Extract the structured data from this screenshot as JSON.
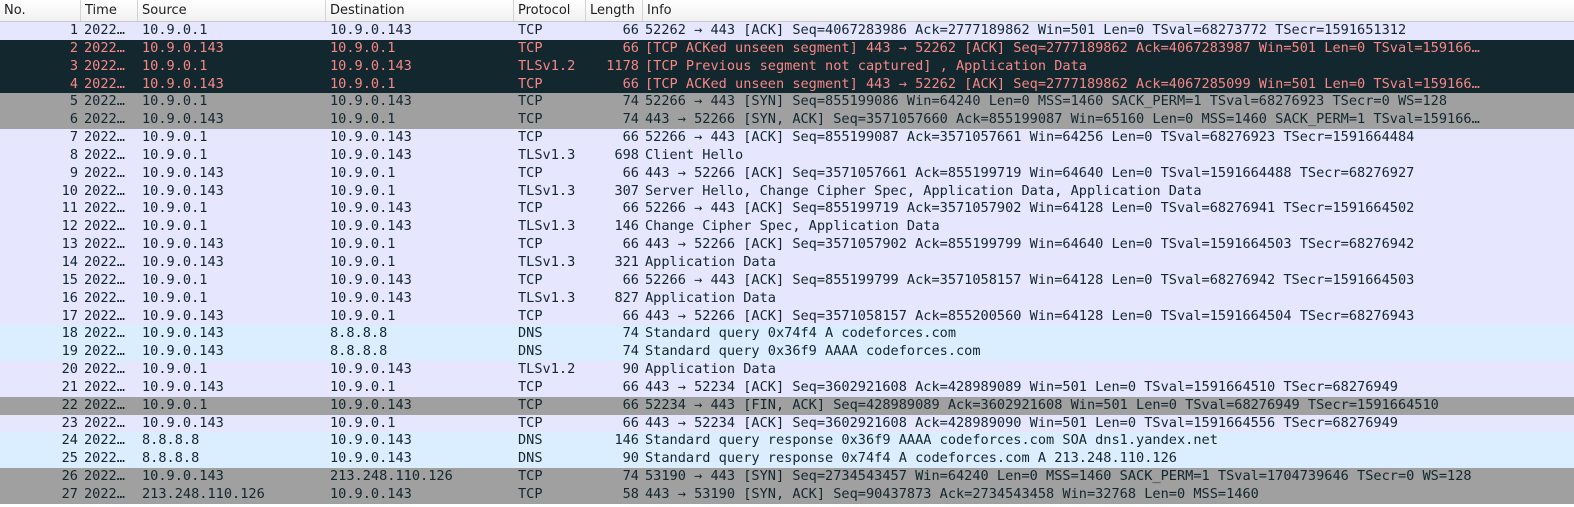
{
  "columns": {
    "no": "No.",
    "time": "Time",
    "source": "Source",
    "destination": "Destination",
    "protocol": "Protocol",
    "length": "Length",
    "info": "Info"
  },
  "row_colors": {
    "tcp": "#e7e6ff",
    "dns": "#daeeff",
    "error_bg": "#12272e",
    "error_text": "#f78787",
    "flag_gray": "#a0a0a0"
  },
  "packets": [
    {
      "no": "1",
      "time": "2022…",
      "source": "10.9.0.1",
      "destination": "10.9.0.143",
      "protocol": "TCP",
      "length": "66",
      "info": "52262 → 443 [ACK] Seq=4067283986 Ack=2777189862 Win=501 Len=0 TSval=68273772 TSecr=1591651312",
      "style": "tcp"
    },
    {
      "no": "2",
      "time": "2022…",
      "source": "10.9.0.143",
      "destination": "10.9.0.1",
      "protocol": "TCP",
      "length": "66",
      "info": "[TCP ACKed unseen segment] 443 → 52262 [ACK] Seq=2777189862 Ack=4067283987 Win=501 Len=0 TSval=159166…",
      "style": "err"
    },
    {
      "no": "3",
      "time": "2022…",
      "source": "10.9.0.1",
      "destination": "10.9.0.143",
      "protocol": "TLSv1.2",
      "length": "1178",
      "info": "[TCP Previous segment not captured] , Application Data",
      "style": "err"
    },
    {
      "no": "4",
      "time": "2022…",
      "source": "10.9.0.143",
      "destination": "10.9.0.1",
      "protocol": "TCP",
      "length": "66",
      "info": "[TCP ACKed unseen segment] 443 → 52262 [ACK] Seq=2777189862 Ack=4067285099 Win=501 Len=0 TSval=159166…",
      "style": "err"
    },
    {
      "no": "5",
      "time": "2022…",
      "source": "10.9.0.1",
      "destination": "10.9.0.143",
      "protocol": "TCP",
      "length": "74",
      "info": "52266 → 443 [SYN] Seq=855199086 Win=64240 Len=0 MSS=1460 SACK_PERM=1 TSval=68276923 TSecr=0 WS=128",
      "style": "syn"
    },
    {
      "no": "6",
      "time": "2022…",
      "source": "10.9.0.143",
      "destination": "10.9.0.1",
      "protocol": "TCP",
      "length": "74",
      "info": "443 → 52266 [SYN, ACK] Seq=3571057660 Ack=855199087 Win=65160 Len=0 MSS=1460 SACK_PERM=1 TSval=159166…",
      "style": "syn"
    },
    {
      "no": "7",
      "time": "2022…",
      "source": "10.9.0.1",
      "destination": "10.9.0.143",
      "protocol": "TCP",
      "length": "66",
      "info": "52266 → 443 [ACK] Seq=855199087 Ack=3571057661 Win=64256 Len=0 TSval=68276923 TSecr=1591664484",
      "style": "tcp"
    },
    {
      "no": "8",
      "time": "2022…",
      "source": "10.9.0.1",
      "destination": "10.9.0.143",
      "protocol": "TLSv1.3",
      "length": "698",
      "info": "Client Hello",
      "style": "tcp"
    },
    {
      "no": "9",
      "time": "2022…",
      "source": "10.9.0.143",
      "destination": "10.9.0.1",
      "protocol": "TCP",
      "length": "66",
      "info": "443 → 52266 [ACK] Seq=3571057661 Ack=855199719 Win=64640 Len=0 TSval=1591664488 TSecr=68276927",
      "style": "tcp"
    },
    {
      "no": "10",
      "time": "2022…",
      "source": "10.9.0.143",
      "destination": "10.9.0.1",
      "protocol": "TLSv1.3",
      "length": "307",
      "info": "Server Hello, Change Cipher Spec, Application Data, Application Data",
      "style": "tcp"
    },
    {
      "no": "11",
      "time": "2022…",
      "source": "10.9.0.1",
      "destination": "10.9.0.143",
      "protocol": "TCP",
      "length": "66",
      "info": "52266 → 443 [ACK] Seq=855199719 Ack=3571057902 Win=64128 Len=0 TSval=68276941 TSecr=1591664502",
      "style": "tcp"
    },
    {
      "no": "12",
      "time": "2022…",
      "source": "10.9.0.1",
      "destination": "10.9.0.143",
      "protocol": "TLSv1.3",
      "length": "146",
      "info": "Change Cipher Spec, Application Data",
      "style": "tcp"
    },
    {
      "no": "13",
      "time": "2022…",
      "source": "10.9.0.143",
      "destination": "10.9.0.1",
      "protocol": "TCP",
      "length": "66",
      "info": "443 → 52266 [ACK] Seq=3571057902 Ack=855199799 Win=64640 Len=0 TSval=1591664503 TSecr=68276942",
      "style": "tcp"
    },
    {
      "no": "14",
      "time": "2022…",
      "source": "10.9.0.143",
      "destination": "10.9.0.1",
      "protocol": "TLSv1.3",
      "length": "321",
      "info": "Application Data",
      "style": "tcp"
    },
    {
      "no": "15",
      "time": "2022…",
      "source": "10.9.0.1",
      "destination": "10.9.0.143",
      "protocol": "TCP",
      "length": "66",
      "info": "52266 → 443 [ACK] Seq=855199799 Ack=3571058157 Win=64128 Len=0 TSval=68276942 TSecr=1591664503",
      "style": "tcp"
    },
    {
      "no": "16",
      "time": "2022…",
      "source": "10.9.0.1",
      "destination": "10.9.0.143",
      "protocol": "TLSv1.3",
      "length": "827",
      "info": "Application Data",
      "style": "tcp"
    },
    {
      "no": "17",
      "time": "2022…",
      "source": "10.9.0.143",
      "destination": "10.9.0.1",
      "protocol": "TCP",
      "length": "66",
      "info": "443 → 52266 [ACK] Seq=3571058157 Ack=855200560 Win=64128 Len=0 TSval=1591664504 TSecr=68276943",
      "style": "tcp"
    },
    {
      "no": "18",
      "time": "2022…",
      "source": "10.9.0.143",
      "destination": "8.8.8.8",
      "protocol": "DNS",
      "length": "74",
      "info": "Standard query 0x74f4 A codeforces.com",
      "style": "dns"
    },
    {
      "no": "19",
      "time": "2022…",
      "source": "10.9.0.143",
      "destination": "8.8.8.8",
      "protocol": "DNS",
      "length": "74",
      "info": "Standard query 0x36f9 AAAA codeforces.com",
      "style": "dns"
    },
    {
      "no": "20",
      "time": "2022…",
      "source": "10.9.0.1",
      "destination": "10.9.0.143",
      "protocol": "TLSv1.2",
      "length": "90",
      "info": "Application Data",
      "style": "tcp"
    },
    {
      "no": "21",
      "time": "2022…",
      "source": "10.9.0.143",
      "destination": "10.9.0.1",
      "protocol": "TCP",
      "length": "66",
      "info": "443 → 52234 [ACK] Seq=3602921608 Ack=428989089 Win=501 Len=0 TSval=1591664510 TSecr=68276949",
      "style": "tcp"
    },
    {
      "no": "22",
      "time": "2022…",
      "source": "10.9.0.1",
      "destination": "10.9.0.143",
      "protocol": "TCP",
      "length": "66",
      "info": "52234 → 443 [FIN, ACK] Seq=428989089 Ack=3602921608 Win=501 Len=0 TSval=68276949 TSecr=1591664510",
      "style": "syn"
    },
    {
      "no": "23",
      "time": "2022…",
      "source": "10.9.0.143",
      "destination": "10.9.0.1",
      "protocol": "TCP",
      "length": "66",
      "info": "443 → 52234 [ACK] Seq=3602921608 Ack=428989090 Win=501 Len=0 TSval=1591664556 TSecr=68276949",
      "style": "tcp"
    },
    {
      "no": "24",
      "time": "2022…",
      "source": "8.8.8.8",
      "destination": "10.9.0.143",
      "protocol": "DNS",
      "length": "146",
      "info": "Standard query response 0x36f9 AAAA codeforces.com SOA dns1.yandex.net",
      "style": "dns"
    },
    {
      "no": "25",
      "time": "2022…",
      "source": "8.8.8.8",
      "destination": "10.9.0.143",
      "protocol": "DNS",
      "length": "90",
      "info": "Standard query response 0x74f4 A codeforces.com A 213.248.110.126",
      "style": "dns"
    },
    {
      "no": "26",
      "time": "2022…",
      "source": "10.9.0.143",
      "destination": "213.248.110.126",
      "protocol": "TCP",
      "length": "74",
      "info": "53190 → 443 [SYN] Seq=2734543457 Win=64240 Len=0 MSS=1460 SACK_PERM=1 TSval=1704739646 TSecr=0 WS=128",
      "style": "syn"
    },
    {
      "no": "27",
      "time": "2022…",
      "source": "213.248.110.126",
      "destination": "10.9.0.143",
      "protocol": "TCP",
      "length": "58",
      "info": "443 → 53190 [SYN, ACK] Seq=90437873 Ack=2734543458 Win=32768 Len=0 MSS=1460",
      "style": "syn"
    }
  ]
}
